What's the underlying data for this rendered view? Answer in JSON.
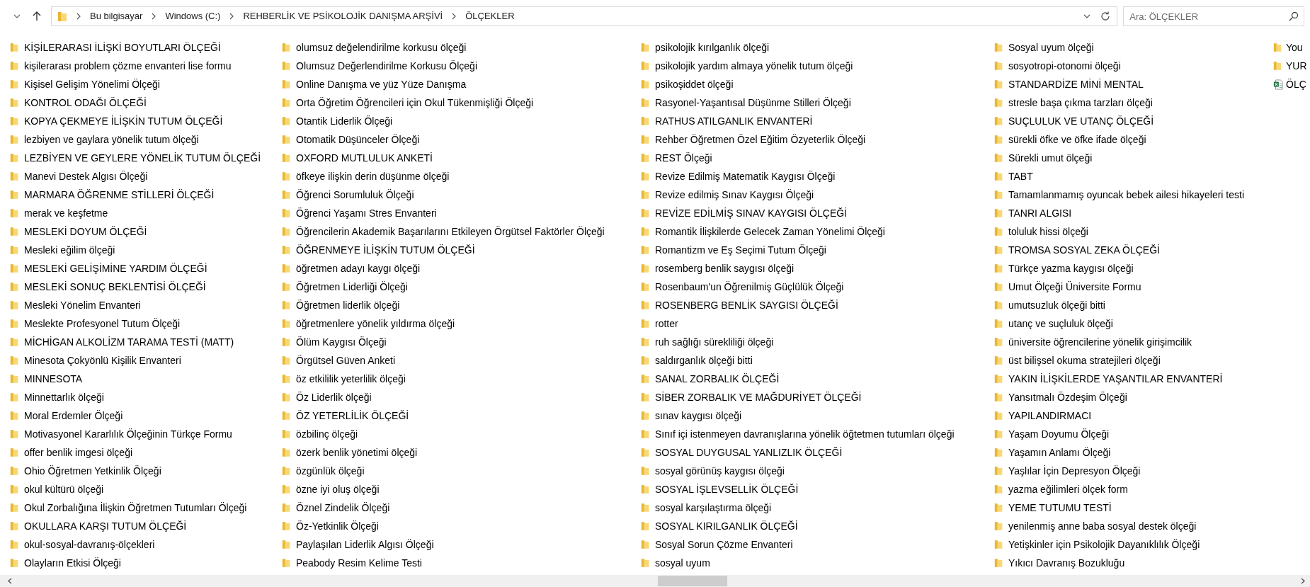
{
  "address_bar": {
    "breadcrumbs": [
      "Bu bilgisayar",
      "Windows (C:)",
      "REHBERLİK VE PSİKOLOJİK DANIŞMA ARŞİVİ",
      "ÖLÇEKLER"
    ]
  },
  "search": {
    "placeholder": "Ara: ÖLÇEKLER"
  },
  "file_list": {
    "columns": [
      {
        "items": [
          {
            "kind": "folder",
            "name": "KİŞİLERARASI İLİŞKİ BOYUTLARI ÖLÇEĞİ"
          },
          {
            "kind": "folder",
            "name": "kişilerarası problem çözme envanteri lise formu"
          },
          {
            "kind": "folder",
            "name": "Kişisel Gelişim Yönelimi Ölçeği"
          },
          {
            "kind": "folder",
            "name": "KONTROL ODAĞI ÖLÇEĞİ"
          },
          {
            "kind": "folder",
            "name": "KOPYA ÇEKMEYE İLİŞKİN TUTUM ÖLÇEĞİ"
          },
          {
            "kind": "folder",
            "name": "lezbiyen ve gaylara yönelik tutum ölçeği"
          },
          {
            "kind": "folder",
            "name": "LEZBİYEN VE GEYLERE YÖNELİK TUTUM ÖLÇEĞİ"
          },
          {
            "kind": "folder",
            "name": "Manevi Destek Algısı Ölçeği"
          },
          {
            "kind": "folder",
            "name": "MARMARA ÖĞRENME STİLLERİ ÖLÇEĞİ"
          },
          {
            "kind": "folder",
            "name": "merak ve keşfetme"
          },
          {
            "kind": "folder",
            "name": "MESLEKİ DOYUM ÖLÇEĞİ"
          },
          {
            "kind": "folder",
            "name": "Mesleki eğilim ölçeği"
          },
          {
            "kind": "folder",
            "name": "MESLEKİ GELİŞİMİNE YARDIM ÖLÇEĞİ"
          },
          {
            "kind": "folder",
            "name": "MESLEKİ SONUÇ BEKLENTİSİ ÖLÇEĞİ"
          },
          {
            "kind": "folder",
            "name": "Mesleki Yönelim Envanteri"
          },
          {
            "kind": "folder",
            "name": "Meslekte Profesyonel Tutum Ölçeği"
          },
          {
            "kind": "folder",
            "name": "MİCHİGAN ALKOLİZM TARAMA TESTİ (MATT)"
          },
          {
            "kind": "folder",
            "name": "Minesota Çokyönlü Kişilik Envanteri"
          },
          {
            "kind": "folder",
            "name": "MINNESOTA"
          },
          {
            "kind": "folder",
            "name": "Minnettarlık ölçeği"
          },
          {
            "kind": "folder",
            "name": "Moral Erdemler Ölçeği"
          },
          {
            "kind": "folder",
            "name": "Motivasyonel Kararlılık Ölçeğinin Türkçe Formu"
          },
          {
            "kind": "folder",
            "name": "offer benlik imgesi ölçeği"
          },
          {
            "kind": "folder",
            "name": "Ohio Öğretmen Yetkinlik Ölçeği"
          },
          {
            "kind": "folder",
            "name": "okul kültürü ölçeği"
          },
          {
            "kind": "folder",
            "name": "Okul Zorbalığına İlişkin Öğretmen Tutumları Ölçeği"
          },
          {
            "kind": "folder",
            "name": "OKULLARA KARŞI TUTUM ÖLÇEĞİ"
          },
          {
            "kind": "folder",
            "name": "okul-sosyal-davranış-ölçekleri"
          },
          {
            "kind": "folder",
            "name": "Olayların Etkisi Ölçeği"
          }
        ]
      },
      {
        "items": [
          {
            "kind": "folder",
            "name": "olumsuz değelendirilme korkusu ölçeği"
          },
          {
            "kind": "folder",
            "name": "Olumsuz Değerlendirilme Korkusu Ölçeği"
          },
          {
            "kind": "folder",
            "name": "Online Danışma ve yüz Yüze Danışma"
          },
          {
            "kind": "folder",
            "name": "Orta Öğretim Öğrencileri için Okul Tükenmişliği Ölçeği"
          },
          {
            "kind": "folder",
            "name": "Otantik Liderlik Ölçeği"
          },
          {
            "kind": "folder",
            "name": "Otomatik Düşünceler Ölçeği"
          },
          {
            "kind": "folder",
            "name": "OXFORD MUTLULUK ANKETİ"
          },
          {
            "kind": "folder",
            "name": "öfkeye ilişkin derin düşünme ölçeği"
          },
          {
            "kind": "folder",
            "name": "Öğrenci Sorumluluk Ölçeği"
          },
          {
            "kind": "folder",
            "name": "Öğrenci Yaşamı Stres Envanteri"
          },
          {
            "kind": "folder",
            "name": "Öğrencilerin Akademik Başarılarını Etkileyen Örgütsel Faktörler Ölçeği"
          },
          {
            "kind": "folder",
            "name": "ÖĞRENMEYE İLİŞKİN TUTUM ÖLÇEĞİ"
          },
          {
            "kind": "folder",
            "name": "öğretmen adayı kaygı ölçeği"
          },
          {
            "kind": "folder",
            "name": "Öğretmen Liderliği Ölçeği"
          },
          {
            "kind": "folder",
            "name": "Öğretmen liderlik ölçeği"
          },
          {
            "kind": "folder",
            "name": "öğretmenlere yönelik yıldırma ölçeği"
          },
          {
            "kind": "folder",
            "name": "Ölüm Kaygısı Ölçeği"
          },
          {
            "kind": "folder",
            "name": "Örgütsel Güven Anketi"
          },
          {
            "kind": "folder",
            "name": "öz etkililik yeterlilik ölçeği"
          },
          {
            "kind": "folder",
            "name": "Öz Liderlik  ölçeği"
          },
          {
            "kind": "folder",
            "name": "ÖZ YETERLİLİK ÖLÇEĞİ"
          },
          {
            "kind": "folder",
            "name": "özbilinç ölçeği"
          },
          {
            "kind": "folder",
            "name": "özerk benlik yönetimi ölçeği"
          },
          {
            "kind": "folder",
            "name": "özgünlük ölçeği"
          },
          {
            "kind": "folder",
            "name": "özne iyi oluş ölçeği"
          },
          {
            "kind": "folder",
            "name": "Öznel Zindelik Ölçeği"
          },
          {
            "kind": "folder",
            "name": "Öz-Yetkinlik Ölçeği"
          },
          {
            "kind": "folder",
            "name": "Paylaşılan Liderlik Algısı Ölçeği"
          },
          {
            "kind": "folder",
            "name": "Peabody Resim Kelime Testi"
          }
        ]
      },
      {
        "items": [
          {
            "kind": "folder",
            "name": "psikolojik kırılganlık ölçeği"
          },
          {
            "kind": "folder",
            "name": "psikolojik yardım almaya yönelik tutum ölçeği"
          },
          {
            "kind": "folder",
            "name": "psikoşiddet ölçeği"
          },
          {
            "kind": "folder",
            "name": "Rasyonel-Yaşantısal Düşünme Stilleri Ölçeği"
          },
          {
            "kind": "folder",
            "name": "RATHUS ATILGANLIK ENVANTERİ"
          },
          {
            "kind": "folder",
            "name": "Rehber Öğretmen Özel Eğitim Özyeterlik Ölçeği"
          },
          {
            "kind": "folder",
            "name": "REST Ölçeği"
          },
          {
            "kind": "folder",
            "name": "Revize Edilmiş Matematik Kaygısı Ölçeği"
          },
          {
            "kind": "folder",
            "name": "Revize edilmiş Sınav Kaygısı Ölçeği"
          },
          {
            "kind": "folder",
            "name": "REVİZE EDİLMİŞ SINAV KAYGISI ÖLÇEĞİ"
          },
          {
            "kind": "folder",
            "name": "Romantik İlişkilerde Gelecek Zaman Yönelimi Ölçeği"
          },
          {
            "kind": "folder",
            "name": "Romantizm ve Eş Seçimi Tutum Ölçeği"
          },
          {
            "kind": "folder",
            "name": "rosemberg benlik saygısı ölçeği"
          },
          {
            "kind": "folder",
            "name": "Rosenbaum'un Öğrenilmiş Güçlülük Ölçeği"
          },
          {
            "kind": "folder",
            "name": "ROSENBERG BENLİK SAYGISI ÖLÇEĞİ"
          },
          {
            "kind": "folder",
            "name": "rotter"
          },
          {
            "kind": "folder",
            "name": "ruh sağlığı sürekliliği ölçeği"
          },
          {
            "kind": "folder",
            "name": "saldırganlık ölçeği bitti"
          },
          {
            "kind": "folder",
            "name": "SANAL ZORBALIK ÖLÇEĞİ"
          },
          {
            "kind": "folder",
            "name": "SİBER ZORBALIK VE MAĞDURİYET ÖLÇEĞİ"
          },
          {
            "kind": "folder",
            "name": "sınav kaygısı ölçeği"
          },
          {
            "kind": "folder",
            "name": "Sınıf içi istenmeyen davranışlarına yönelik öğtetmen tutumları ölçeği"
          },
          {
            "kind": "folder",
            "name": "SOSYAL DUYGUSAL YANLIZLIK ÖLÇEĞİ"
          },
          {
            "kind": "folder",
            "name": "sosyal görünüş kaygısı ölçeği"
          },
          {
            "kind": "folder",
            "name": "SOSYAL İŞLEVSELLİK ÖLÇEĞİ"
          },
          {
            "kind": "folder",
            "name": "sosyal karşılaştırma ölçeği"
          },
          {
            "kind": "folder",
            "name": "SOSYAL KIRILGANLIK ÖLÇEĞİ"
          },
          {
            "kind": "folder",
            "name": "Sosyal Sorun Çözme Envanteri"
          },
          {
            "kind": "folder",
            "name": "sosyal uyum"
          }
        ]
      },
      {
        "items": [
          {
            "kind": "folder",
            "name": "Sosyal uyum ölçeği"
          },
          {
            "kind": "folder",
            "name": "sosyotropi-otonomi ölçeği"
          },
          {
            "kind": "folder",
            "name": "STANDARDİZE MİNİ MENTAL"
          },
          {
            "kind": "folder",
            "name": "stresle başa çıkma tarzları ölçeği"
          },
          {
            "kind": "folder",
            "name": "SUÇLULUK VE UTANÇ ÖLÇEĞİ"
          },
          {
            "kind": "folder",
            "name": "sürekli öfke ve öfke ifade ölçeği"
          },
          {
            "kind": "folder",
            "name": "Sürekli umut ölçeği"
          },
          {
            "kind": "folder",
            "name": "TABT"
          },
          {
            "kind": "folder",
            "name": "Tamamlanmamış oyuncak bebek ailesi hikayeleri testi"
          },
          {
            "kind": "folder",
            "name": "TANRI ALGISI"
          },
          {
            "kind": "folder",
            "name": "toluluk hissi ölçeği"
          },
          {
            "kind": "folder",
            "name": "TROMSA SOSYAL ZEKA ÖLÇEĞİ"
          },
          {
            "kind": "folder",
            "name": "Türkçe yazma kaygısı ölçeği"
          },
          {
            "kind": "folder",
            "name": "Umut Ölçeği Üniversite Formu"
          },
          {
            "kind": "folder",
            "name": "umutsuzluk ölçeği bitti"
          },
          {
            "kind": "folder",
            "name": "utanç ve suçluluk ölçeği"
          },
          {
            "kind": "folder",
            "name": "üniversite öğrencilerine yönelik girişimcilik"
          },
          {
            "kind": "folder",
            "name": "üst bilişsel okuma stratejileri ölçeği"
          },
          {
            "kind": "folder",
            "name": "YAKIN İLİŞKİLERDE YAŞANTILAR  ENVANTERİ"
          },
          {
            "kind": "folder",
            "name": "Yansıtmalı Özdeşim Ölçeği"
          },
          {
            "kind": "folder",
            "name": "YAPILANDIRMACI"
          },
          {
            "kind": "folder",
            "name": "Yaşam Doyumu Ölçeği"
          },
          {
            "kind": "folder",
            "name": "Yaşamın Anlamı Ölçeği"
          },
          {
            "kind": "folder",
            "name": "Yaşlılar İçin Depresyon Ölçeği"
          },
          {
            "kind": "folder",
            "name": "yazma eğilimleri ölçek form"
          },
          {
            "kind": "folder",
            "name": "YEME TUTUMU TESTİ"
          },
          {
            "kind": "folder",
            "name": "yenilenmiş anne baba sosyal destek ölçeği"
          },
          {
            "kind": "folder",
            "name": "Yetişkinler için Psikolojik Dayanıklılık Ölçeği"
          },
          {
            "kind": "folder",
            "name": "Yıkıcı Davranış Bozukluğu"
          }
        ]
      },
      {
        "items": [
          {
            "kind": "folder",
            "name": "You"
          },
          {
            "kind": "folder",
            "name": "YUR"
          },
          {
            "kind": "spreadsheet",
            "name": "ÖLÇ"
          }
        ]
      }
    ]
  }
}
